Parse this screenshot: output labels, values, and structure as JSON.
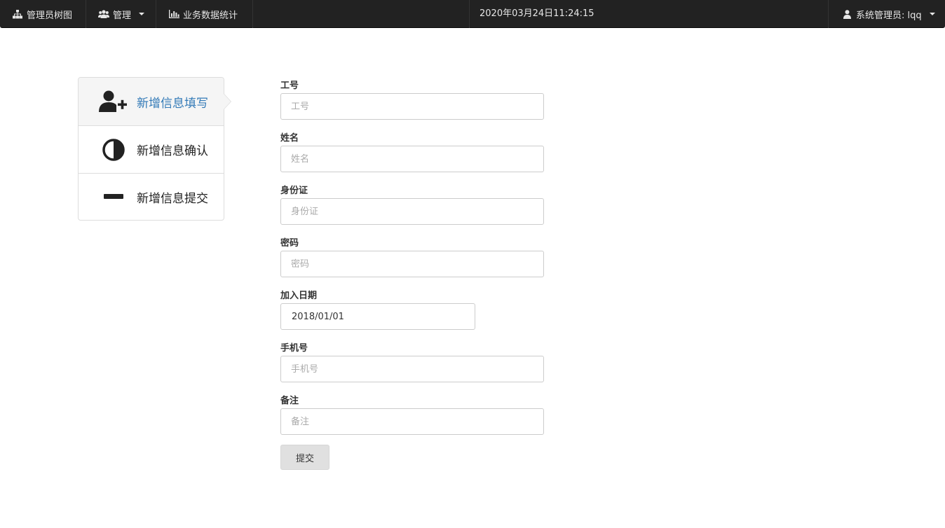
{
  "navbar": {
    "tree_label": "管理员树图",
    "manage_label": "管理",
    "stats_label": "业务数据统计",
    "datetime": "2020年03月24日11:24:15",
    "user_label": "系统管理员: lqq"
  },
  "steps": [
    {
      "label": "新增信息填写",
      "icon": "user-plus-icon",
      "active": true
    },
    {
      "label": "新增信息确认",
      "icon": "half-circle-icon",
      "active": false
    },
    {
      "label": "新增信息提交",
      "icon": "minus-icon",
      "active": false
    }
  ],
  "form": {
    "fields": [
      {
        "label": "工号",
        "placeholder": "工号",
        "value": ""
      },
      {
        "label": "姓名",
        "placeholder": "姓名",
        "value": ""
      },
      {
        "label": "身份证",
        "placeholder": "身份证",
        "value": ""
      },
      {
        "label": "密码",
        "placeholder": "密码",
        "value": ""
      },
      {
        "label": "加入日期",
        "placeholder": "",
        "value": "2018/01/01"
      },
      {
        "label": "手机号",
        "placeholder": "手机号",
        "value": ""
      },
      {
        "label": "备注",
        "placeholder": "备注",
        "value": ""
      }
    ],
    "submit_label": "提交"
  },
  "colors": {
    "navbar_bg": "#222222",
    "active_step_text": "#337ab7",
    "active_step_bg": "#f5f5f5"
  }
}
